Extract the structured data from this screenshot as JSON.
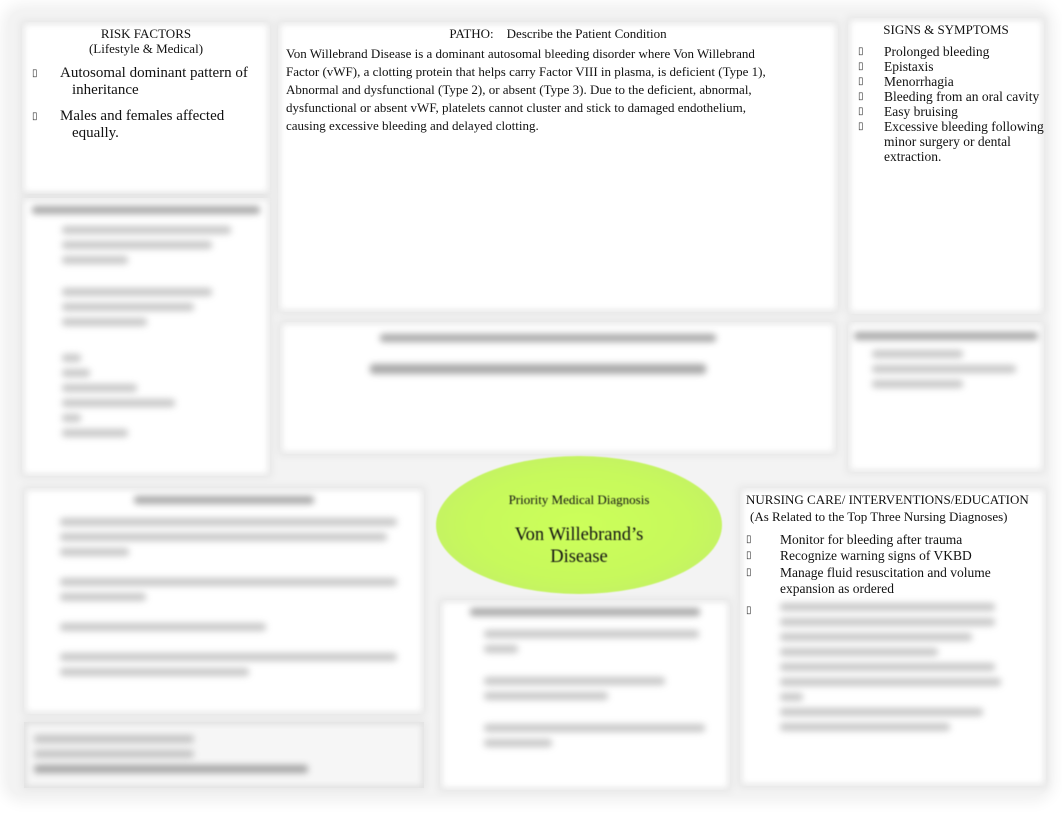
{
  "risk_factors": {
    "title": "RISK FACTORS",
    "subtitle": "(Lifestyle & Medical)",
    "items": [
      "Autosomal dominant pattern of inheritance",
      "Males and females affected equally."
    ]
  },
  "patho": {
    "title": "PATHO:    Describe the Patient Condition",
    "text": "Von Willebrand Disease is a dominant autosomal bleeding disorder where Von Willebrand Factor (vWF), a clotting protein that helps carry Factor VIII in plasma, is deficient (Type 1), Abnormal and dysfunctional (Type 2), or absent (Type 3). Due to the deficient, abnormal, dysfunctional or absent vWF, platelets cannot cluster and stick to damaged endothelium, causing excessive bleeding and delayed clotting."
  },
  "signs_symptoms": {
    "title": "SIGNS & SYMPTOMS",
    "items": [
      "Prolonged bleeding",
      "Epistaxis",
      "Menorrhagia",
      "Bleeding from an oral cavity",
      "Easy bruising",
      "Excessive bleeding following minor surgery or dental extraction."
    ]
  },
  "priority_diagnosis": {
    "label": "Priority Medical Diagnosis",
    "value": "Von Willebrand’s Disease",
    "color": "#ccff5a"
  },
  "nursing_care": {
    "title": "NURSING CARE/ INTERVENTIONS/EDUCATION",
    "subtitle": "(As Related to the Top Three Nursing Diagnoses)",
    "items": [
      "Monitor for bleeding after trauma",
      "Recognize warning signs of VKBD",
      "Manage fluid resuscitation and volume expansion as ordered",
      ""
    ]
  },
  "bullet_glyph": "▯"
}
